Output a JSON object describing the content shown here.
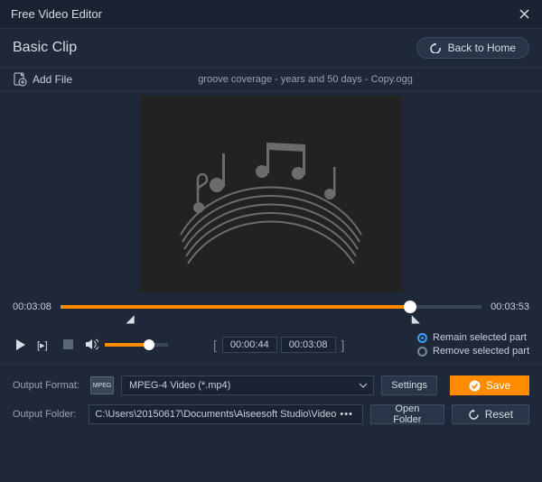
{
  "titlebar": {
    "title": "Free Video Editor"
  },
  "header": {
    "title": "Basic Clip",
    "back": "Back to Home"
  },
  "file": {
    "add": "Add File",
    "name": "groove coverage - years and 50 days - Copy.ogg"
  },
  "timeline": {
    "current": "00:03:08",
    "total": "00:03:53"
  },
  "range": {
    "start": "00:00:44",
    "end": "00:03:08"
  },
  "options": {
    "remain": "Remain selected part",
    "remove": "Remove selected part"
  },
  "output": {
    "formatLabel": "Output Format:",
    "formatIcon": "MPEG",
    "format": "MPEG-4 Video (*.mp4)",
    "settings": "Settings",
    "folderLabel": "Output Folder:",
    "folder": "C:\\Users\\20150617\\Documents\\Aiseesoft Studio\\Video",
    "open": "Open Folder",
    "save": "Save",
    "reset": "Reset"
  }
}
